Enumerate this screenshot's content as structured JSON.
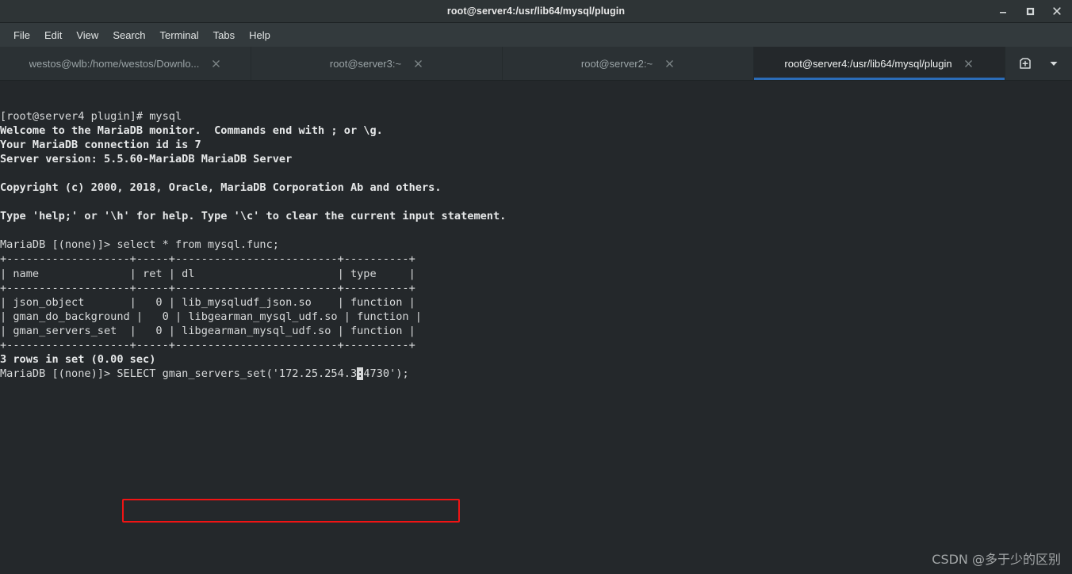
{
  "window": {
    "title": "root@server4:/usr/lib64/mysql/plugin",
    "controls": {
      "minimize": "minimize-button",
      "maximize": "maximize-button",
      "close": "close-button"
    }
  },
  "menubar": {
    "items": [
      {
        "label": "File"
      },
      {
        "label": "Edit"
      },
      {
        "label": "View"
      },
      {
        "label": "Search"
      },
      {
        "label": "Terminal"
      },
      {
        "label": "Tabs"
      },
      {
        "label": "Help"
      }
    ]
  },
  "tabs": {
    "items": [
      {
        "label": "westos@wlb:/home/westos/Downlo...",
        "active": false,
        "close": "×"
      },
      {
        "label": "root@server3:~",
        "active": false,
        "close": "×"
      },
      {
        "label": "root@server2:~",
        "active": false,
        "close": "×"
      },
      {
        "label": "root@server4:/usr/lib64/mysql/plugin",
        "active": true,
        "close": "×"
      }
    ],
    "actions": {
      "new_tab": "new-tab-icon",
      "tab_menu": "chevron-down-icon"
    }
  },
  "terminal": {
    "prompt_shell": "[root@server4 plugin]# ",
    "command_shell": "mysql",
    "banner": [
      "Welcome to the MariaDB monitor.  Commands end with ; or \\g.",
      "Your MariaDB connection id is 7",
      "Server version: 5.5.60-MariaDB MariaDB Server",
      "",
      "Copyright (c) 2000, 2018, Oracle, MariaDB Corporation Ab and others.",
      "",
      "Type 'help;' or '\\h' for help. Type '\\c' to clear the current input statement.",
      ""
    ],
    "prompt_sql": "MariaDB [(none)]> ",
    "query_1": "select * from mysql.func;",
    "table": {
      "rule": "+-------------------+-----+-------------------------+----------+",
      "header": "| name              | ret | dl                      | type     |",
      "rows": [
        "| json_object       |   0 | lib_mysqludf_json.so    | function |",
        "| gman_do_background |   0 | libgearman_mysql_udf.so | function |",
        "| gman_servers_set  |   0 | libgearman_mysql_udf.so | function |"
      ],
      "footer": "3 rows in set (0.00 sec)"
    },
    "query_2_before_cursor": "SELECT gman_servers_set('172.25.254.3",
    "query_2_cursor_char": ":",
    "query_2_after_cursor": "4730');",
    "highlight_color": "#f01414"
  },
  "watermark": {
    "text": "CSDN @多于少的区别"
  },
  "colors": {
    "titlebar_bg": "#2e3436",
    "menubar_bg": "#333a3d",
    "tabbar_bg": "#2b3134",
    "terminal_bg": "#24282b",
    "terminal_fg": "#d8dadb",
    "active_tab_underline": "#2b6cb8",
    "annotation_red": "#f01414"
  }
}
